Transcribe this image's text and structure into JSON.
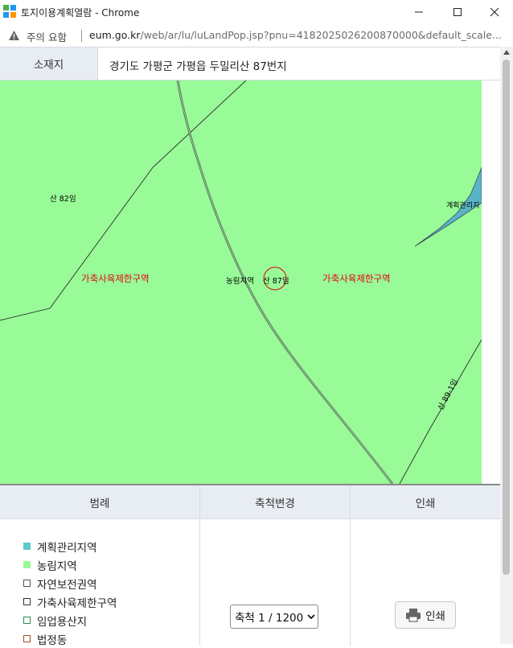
{
  "window": {
    "title": "토지이용계획열람 - Chrome",
    "controls": {
      "minimize": "minimize-icon",
      "maximize": "maximize-icon",
      "close": "close-icon"
    }
  },
  "addressbar": {
    "security_label": "주의 요함",
    "url_host": "eum.go.kr",
    "url_path": "/web/ar/lu/luLandPop.jsp?pnu=4182025026200870000&default_scale..."
  },
  "location": {
    "label": "소재지",
    "value": "경기도 가평군 가평읍 두밀리산 87번지"
  },
  "map": {
    "labels": {
      "parcel_82": "산 82임",
      "agri_forest": "농림지역",
      "parcel_87": "산 87임",
      "plan_mgmt": "계획관리지",
      "parcel_89_1": "산 89-1임"
    },
    "zones": {
      "left": "가축사육제한구역",
      "right": "가축사육제한구역"
    }
  },
  "panel": {
    "legend_header": "범례",
    "scale_header": "축척변경",
    "print_header": "인쇄",
    "legend": [
      {
        "label": "계획관리지역",
        "fill": "#5cc8c8",
        "border": "#5cc8c8"
      },
      {
        "label": "농림지역",
        "fill": "#98fb98",
        "border": "#98fb98"
      },
      {
        "label": "자연보전권역",
        "fill": "#ffffff",
        "border": "#555555"
      },
      {
        "label": "가축사육제한구역",
        "fill": "#ffffff",
        "border": "#333333"
      },
      {
        "label": "임업용산지",
        "fill": "#ffffff",
        "border": "#2e8b57"
      },
      {
        "label": "법정동",
        "fill": "#ffffff",
        "border": "#a0522d"
      }
    ],
    "scale_value": "축척 1 / 1200",
    "print_label": "인쇄"
  },
  "colors": {
    "map_bg": "#98fb98",
    "zone_text": "#e8000b",
    "plan_mgmt_fill": "#5ab4c8",
    "header_bg": "#e8edf3"
  }
}
